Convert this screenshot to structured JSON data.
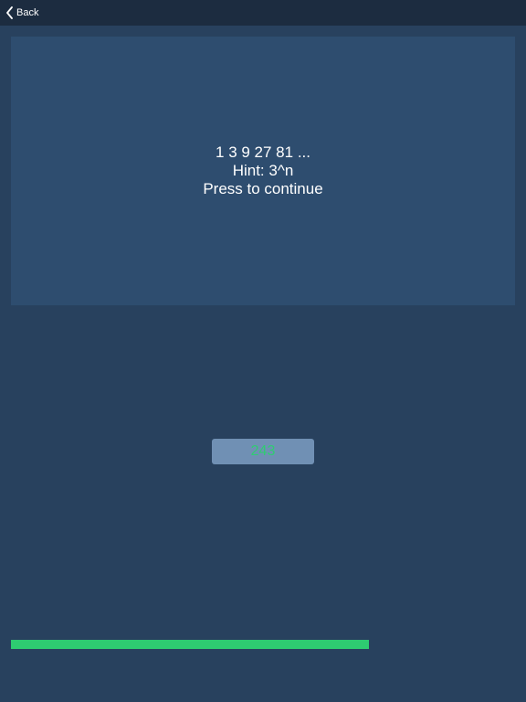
{
  "nav": {
    "back_label": "Back",
    "back_icon": "chevron-left-icon"
  },
  "prompt": {
    "sequence": "1 3 9 27 81 ...",
    "hint": "Hint: 3^n",
    "instruction": "Press to continue"
  },
  "answer": {
    "value": "243"
  },
  "progress": {
    "fraction": 0.71
  },
  "colors": {
    "background": "#28415e",
    "nav_bar": "#1c2c40",
    "card": "#2e4d6f",
    "answer_box": "#7090b4",
    "accent_green": "#2ecc71"
  }
}
